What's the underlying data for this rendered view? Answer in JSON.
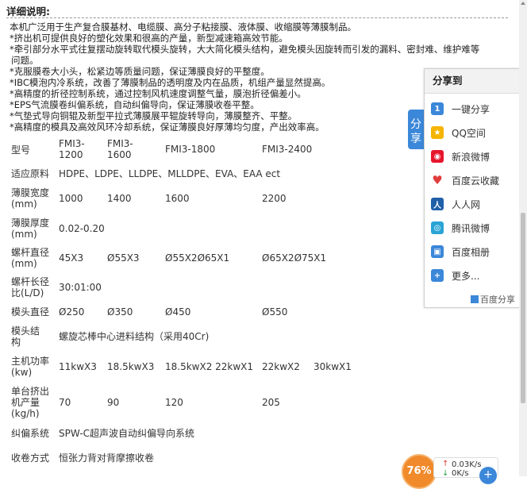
{
  "heading": "详细说明:",
  "intro": [
    "本机广泛用于生产复合膜基材、电缆膜、高分子粘接膜、液体膜、收缩膜等薄膜制品。",
    "*挤出机可提供良好的塑化效果和很高的产量，新型减速箱高效节能。",
    "*牵引部分水平式往复摆动旋转取代模头旋转，大大简化模头结构，避免模头因旋转而引发的漏料、密封难、维护难等",
    "问题。",
    "*克服膜卷大小头，松紧边等质量问题，保证薄膜良好的平整度。",
    "*IBC模泡内冷系统，改善了薄膜制品的透明度及内在品质，机组产量显然提高。",
    "*高精度的折径控制系统，通过控制风机速度调整气量，膜泡折径偏差小。",
    "*EPS气流膜卷纠偏系统，自动纠偏导向，保证薄膜收卷平整。",
    "*气垫式导向铜辊及新型平拉式薄膜展平辊旋转导向，薄膜整齐、平整。",
    "*高精度的模具及高效风环冷却系统，保证薄膜良好厚薄均匀度，产出效率高。"
  ],
  "specs": {
    "model_label": "型号",
    "models": [
      "FMI3-\n1200",
      "FMI3-\n1600",
      "FMI3-1800",
      "FMI3-2400"
    ],
    "material_label": "适应原料",
    "material": "HDPE、LDPE、LLDPE、MLLDPE、EVA、EAA ect",
    "width_label": "薄膜宽度\n(mm)",
    "widths": [
      "1000",
      "1400",
      "1600",
      "2200"
    ],
    "thickness_label": "薄膜厚度\n(mm)",
    "thickness": "0.02-0.20",
    "screw_dia_label": "螺杆直径\n(mm)",
    "screw_dia": [
      "45X3",
      "Ø55X3",
      "Ø55X2Ø65X1",
      "Ø65X2Ø75X1"
    ],
    "ld_label": "螺杆长径\n比(L/D)",
    "ld": "30:01:00",
    "die_label": "模头直径",
    "die": [
      "Ø250",
      "Ø350",
      "Ø450",
      "Ø550"
    ],
    "die_struct_label": "模头结\n构",
    "die_struct": "螺旋芯棒中心进料结构（采用40Cr)",
    "power_label": "主机功率\n(kw)",
    "power": [
      "11kwX3",
      "18.5kwX3",
      "18.5kwX2 22kwX1",
      "22kwX2",
      "30kwX1"
    ],
    "output_label": "单台挤出\n机产量\n(kg/h)",
    "output": [
      "70",
      "90",
      "120",
      "205"
    ],
    "edge_label": "纠偏系统",
    "edge": "SPW-C超声波自动纠偏导向系统",
    "winding_label": "收卷方式",
    "winding": "恒张力背对背摩擦收卷"
  },
  "share": {
    "tab": "分享",
    "title": "分享到",
    "items": [
      {
        "label": "一键分享",
        "icon": "one-click-share-icon",
        "color": "#3b87d9"
      },
      {
        "label": "QQ空间",
        "icon": "qzone-icon",
        "color": "#f5b400"
      },
      {
        "label": "新浪微博",
        "icon": "weibo-icon",
        "color": "#e6162d"
      },
      {
        "label": "百度云收藏",
        "icon": "heart-icon",
        "color": "#e03c3c"
      },
      {
        "label": "人人网",
        "icon": "renren-icon",
        "color": "#1f5fa8"
      },
      {
        "label": "腾讯微博",
        "icon": "tencent-weibo-icon",
        "color": "#2aa4d5"
      },
      {
        "label": "百度相册",
        "icon": "baidu-album-icon",
        "color": "#3b87d9"
      },
      {
        "label": "更多...",
        "icon": "more-icon",
        "color": "#3b87d9"
      }
    ],
    "footer": "百度分享"
  },
  "speed_widget": {
    "percent": "76%",
    "rate": "0.03K/s",
    "rate2": "0K/s"
  }
}
